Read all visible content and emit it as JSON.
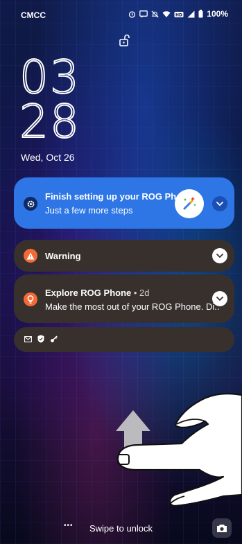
{
  "status_bar": {
    "carrier": "CMCC",
    "icons": [
      "alarm-icon",
      "message-icon",
      "mute-icon",
      "wifi-icon",
      "volte-icon",
      "signal-icon",
      "battery-icon"
    ],
    "battery_percent": "100%"
  },
  "lockscreen": {
    "lock_icon": "unlocked-padlock-icon",
    "clock": {
      "hour": "03",
      "minute": "28"
    },
    "date": "Wed, Oct 26"
  },
  "notifications": [
    {
      "id": "setup",
      "icon": "gear-icon",
      "title": "Finish setting up your ROG Pho..",
      "text": "Just a few more steps",
      "badge_icon": "magic-wand-icon",
      "bg_color": "#2e76e6"
    },
    {
      "id": "warning",
      "icon": "warning-icon",
      "title": "Warning",
      "bg_color": "#37302d"
    },
    {
      "id": "explore",
      "icon": "lightbulb-icon",
      "title": "Explore ROG Phone",
      "age": " • 2d",
      "text": "Make the most out of your ROG Phone. Di..",
      "bg_color": "#37302d"
    }
  ],
  "collapsed_icons": [
    "mail-icon",
    "shield-icon",
    "key-icon"
  ],
  "bottom": {
    "swipe_text": "Swipe to unlock",
    "dots": "•••",
    "camera_icon": "camera-icon"
  },
  "accent_colors": {
    "setup_blue": "#2e76e6",
    "warning_orange": "#f26a36",
    "card_dark": "#37302d"
  }
}
